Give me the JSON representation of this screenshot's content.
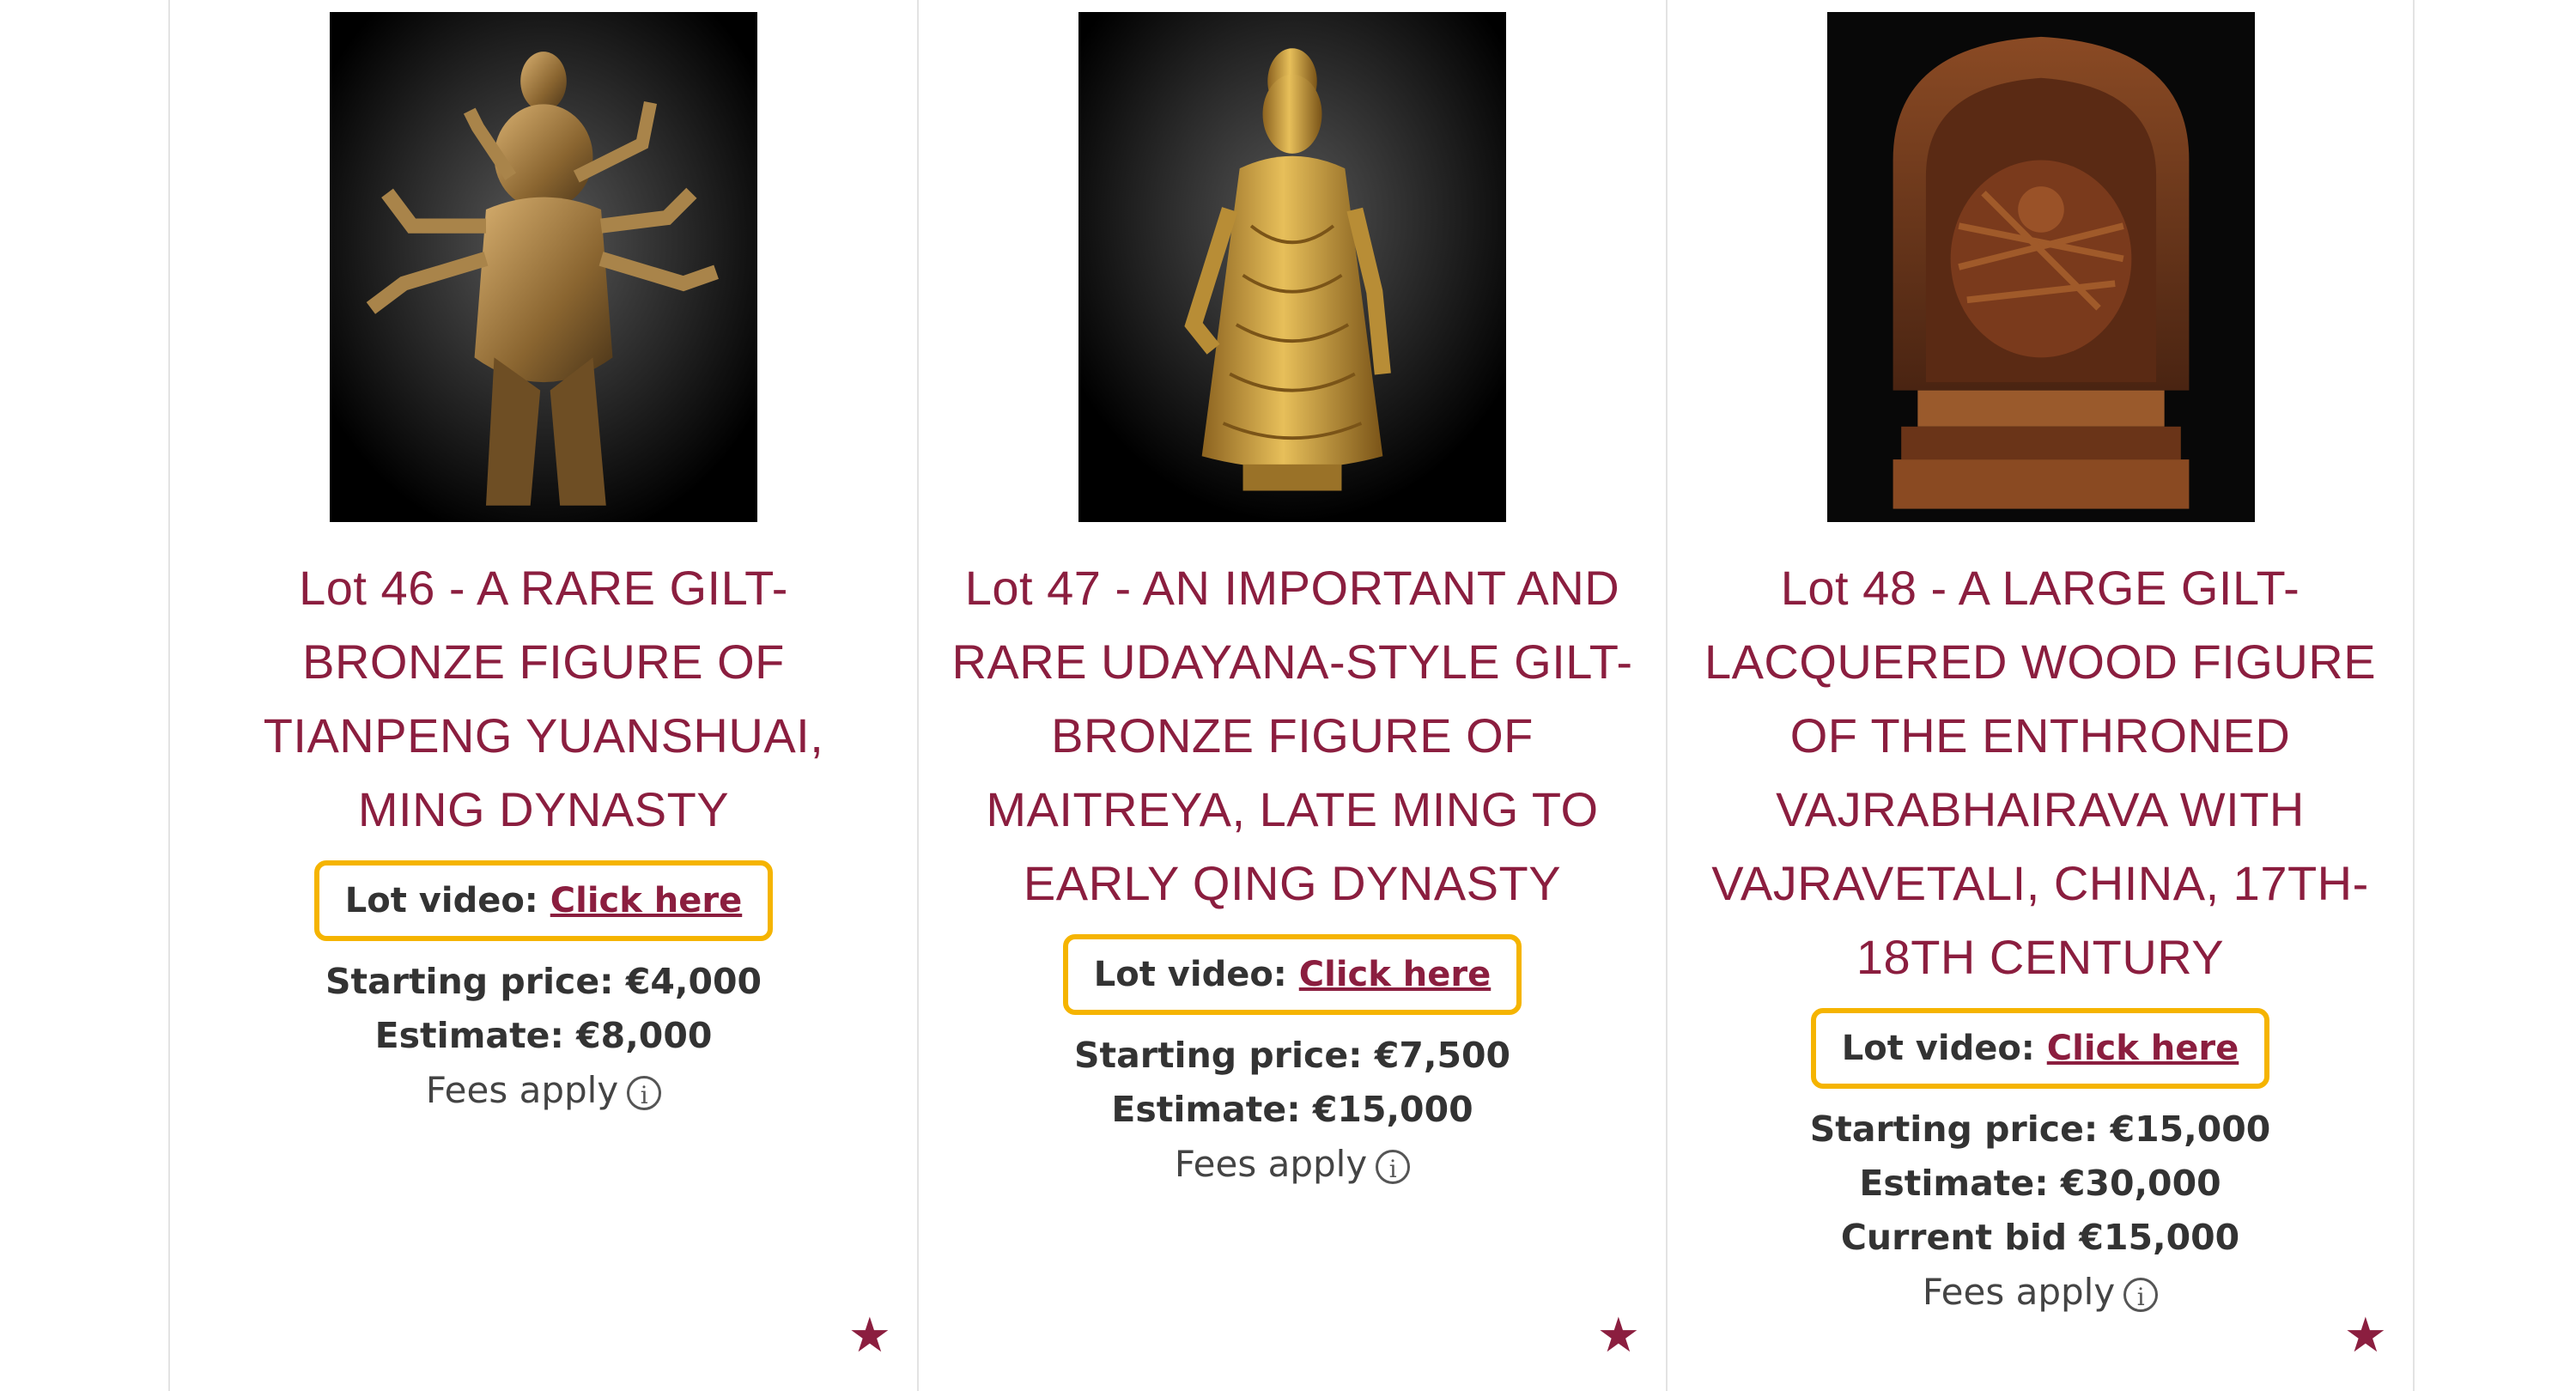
{
  "lots": [
    {
      "title": "Lot 46 - A RARE GILT-BRONZE FIGURE OF TIANPENG YUANSHUAI, MING DYNASTY",
      "video_label": "Lot video:",
      "video_link": "Click here",
      "starting_price": "Starting price: €4,000",
      "estimate": "Estimate: €8,000",
      "fees": "Fees apply",
      "image_icon": "multi-armed-deity-figure"
    },
    {
      "title": "Lot 47 - AN IMPORTANT AND RARE UDAYANA-STYLE GILT-BRONZE FIGURE OF MAITREYA, LATE MING TO EARLY QING DYNASTY",
      "video_label": "Lot video:",
      "video_link": "Click here",
      "starting_price": "Starting price: €7,500",
      "estimate": "Estimate: €15,000",
      "fees": "Fees apply",
      "image_icon": "standing-buddha-figure"
    },
    {
      "title": "Lot 48 - A LARGE GILT-LACQUERED WOOD FIGURE OF THE ENTHRONED VAJRABHAIRAVA WITH VAJRAVETALI, CHINA, 17TH-18TH CENTURY",
      "video_label": "Lot video:",
      "video_link": "Click here",
      "starting_price": "Starting price: €15,000",
      "estimate": "Estimate: €30,000",
      "current_bid": "Current bid €15,000",
      "fees": "Fees apply",
      "image_icon": "enthroned-deity-shrine"
    }
  ],
  "icons": {
    "info": "info-icon",
    "favorite": "star-icon"
  },
  "colors": {
    "title": "#8b1e3f",
    "highlight_border": "#f5b400",
    "star": "#8b1e3f"
  }
}
